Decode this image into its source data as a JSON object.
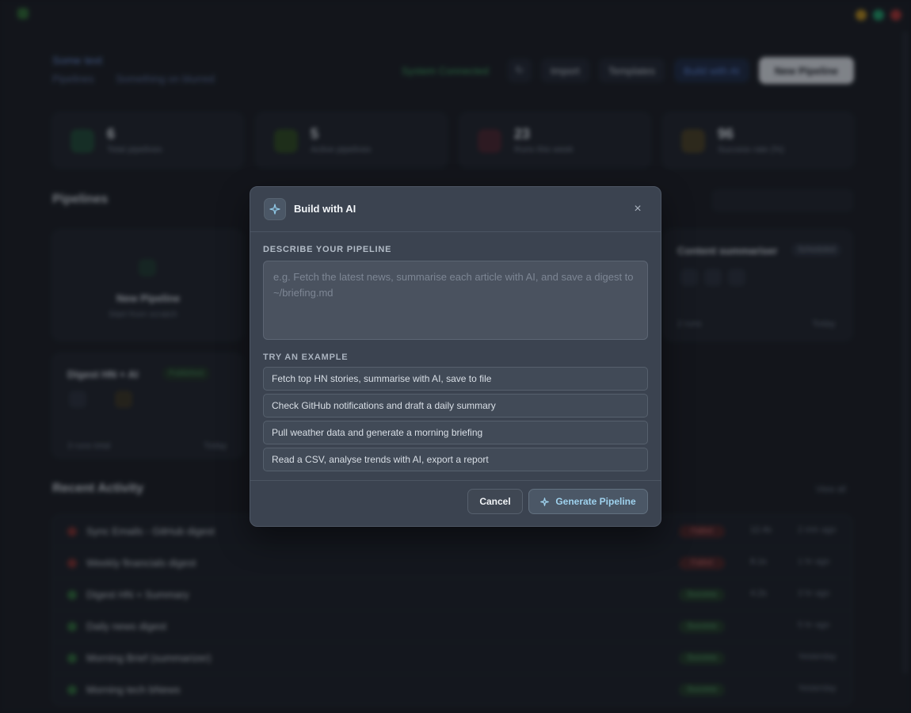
{
  "background": {
    "brand": "Some text",
    "breadcrumb": [
      "Pipelines",
      "Something on blurred"
    ],
    "header_actions": {
      "status": "System Connected",
      "import": "Import",
      "templates": "Templates",
      "ai_button": "Build with AI",
      "new_pipeline": "New Pipeline"
    },
    "stats": [
      {
        "value": "6",
        "label": "Total pipelines",
        "color": "#2a7f52"
      },
      {
        "value": "5",
        "label": "Active pipelines",
        "color": "#3c7a2c"
      },
      {
        "value": "23",
        "label": "Runs this week",
        "color": "#7a3a4e"
      },
      {
        "value": "96",
        "label": "Success rate (%)",
        "color": "#7a6a3a"
      }
    ],
    "pipelines_title": "Pipelines",
    "new_card": {
      "title": "New Pipeline",
      "subtitle": "Start from scratch"
    },
    "card_right": {
      "title": "Content summariser",
      "chip": "Scheduled",
      "meta": "2 runs",
      "time": "Today"
    },
    "card_left": {
      "title": "Digest HN + AI",
      "chip": "Published",
      "meta": "3 runs total",
      "time": "Today"
    },
    "activity_title": "Recent Activity",
    "activity_link": "View all",
    "activity": [
      {
        "name": "Sync Emails - GitHub digest",
        "status": "Failed",
        "color": "#a33a3a",
        "dur": "12.4s",
        "time": "2 min ago"
      },
      {
        "name": "Weekly financials digest",
        "status": "Failed",
        "color": "#a33a3a",
        "dur": "8.1s",
        "time": "1 hr ago"
      },
      {
        "name": "Digest HN + Summary",
        "status": "Success",
        "color": "#2f7d3e",
        "dur": "4.2s",
        "time": "3 hr ago"
      },
      {
        "name": "Daily news digest",
        "status": "Success",
        "color": "#2f7d3e",
        "dur": "",
        "time": "5 hr ago"
      },
      {
        "name": "Morning Brief (summarizer)",
        "status": "Success",
        "color": "#2f7d3e",
        "dur": "",
        "time": "Yesterday"
      },
      {
        "name": "Morning tech bNews",
        "status": "Success",
        "color": "#2f7d3e",
        "dur": "",
        "time": "Yesterday"
      }
    ]
  },
  "modal": {
    "title": "Build with AI",
    "icon": "sparkle-icon",
    "close": "×",
    "describe_label": "DESCRIBE YOUR PIPELINE",
    "prompt_value": "",
    "prompt_placeholder": "e.g. Fetch the latest news, summarise each article with AI, and save a digest to ~/briefing.md",
    "examples_label": "TRY AN EXAMPLE",
    "examples": [
      "Fetch top HN stories, summarise with AI, save to file",
      "Check GitHub notifications and draft a daily summary",
      "Pull weather data and generate a morning briefing",
      "Read a CSV, analyse trends with AI, export a report"
    ],
    "cancel_label": "Cancel",
    "generate_label": "Generate Pipeline"
  },
  "colors": {
    "modal_bg": "#3b4350",
    "accent": "#8ec6e4",
    "overlay": "rgba(12,14,18,0.45)"
  }
}
